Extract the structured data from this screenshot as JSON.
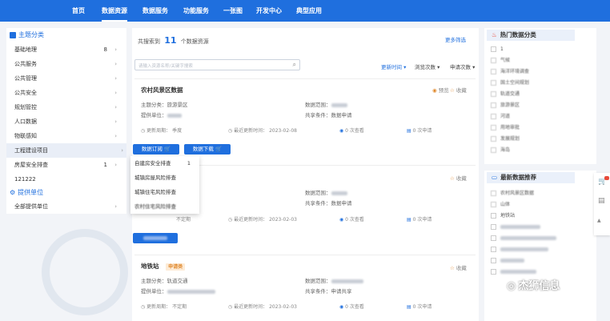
{
  "nav": {
    "items": [
      "首页",
      "数据资源",
      "数据服务",
      "功能服务",
      "一张图",
      "开发中心",
      "典型应用"
    ]
  },
  "sidebar": {
    "theme_title": "主题分类",
    "rows": [
      {
        "label": "基础地理",
        "count": "8"
      },
      {
        "label": "公共服务",
        "count": ""
      },
      {
        "label": "公共管理",
        "count": ""
      },
      {
        "label": "公共安全",
        "count": ""
      },
      {
        "label": "规划管控",
        "count": ""
      },
      {
        "label": "人口数据",
        "count": ""
      },
      {
        "label": "物联感知",
        "count": ""
      },
      {
        "label": "工程建设项目",
        "count": ""
      },
      {
        "label": "房屋安全排查",
        "count": "1"
      },
      {
        "label": "121222",
        "count": ""
      }
    ],
    "provider_title": "提供单位",
    "provider_row": "全部提供单位"
  },
  "main": {
    "found_prefix": "共搜索到",
    "found_count": "11",
    "found_suffix": "个数据资源",
    "more_filter": "更多筛选",
    "search_placeholder": "请输入资源名称/关键字搜索",
    "sort": [
      "更新时间",
      "浏览次数",
      "申请次数"
    ],
    "cards": [
      {
        "title": "农村风景区数据",
        "preview": "预览",
        "fav": "收藏",
        "theme_label": "主题分类：",
        "theme": "旅游景区",
        "provider_label": "提供单位：",
        "range_label": "数据范围：",
        "share_label": "共享条件：",
        "share": "数据申请",
        "freq_label": "更新周期：",
        "freq": "季度",
        "updated_label": "最近更新时间：",
        "updated": "2023-02-08",
        "views": "0 次查看",
        "applies": "0 次申请"
      },
      {
        "fav": "收藏",
        "range_label": "数据范围：",
        "share_label": "共享条件：",
        "share": "数据申请",
        "freq": "不定期",
        "updated_label": "最近更新时间：",
        "updated": "2023-02-03",
        "views": "0 次查看",
        "applies": "0 次申请"
      },
      {
        "title": "地铁站",
        "tag": "申请类",
        "fav": "收藏",
        "theme_label": "主题分类：",
        "theme": "轨道交通",
        "provider_label": "提供单位：",
        "range_label": "数据范围：",
        "share_label": "共享条件：",
        "share": "申请共享",
        "freq_label": "更新周期：",
        "freq": "不定期",
        "updated_label": "最近更新时间：",
        "updated": "2023-02-03",
        "views": "0 次查看",
        "applies": "0 次申请"
      }
    ],
    "subscribe_btn": "数据订阅",
    "download_btn": "数据下载",
    "dropdown": [
      {
        "label": "自建房安全排查",
        "count": "1"
      },
      {
        "label": "城镇房屋风险排查",
        "count": ""
      },
      {
        "label": "城镇住宅风险排查",
        "count": ""
      },
      {
        "label": "农村住宅风险排查",
        "count": ""
      }
    ]
  },
  "right": {
    "hot_title": "热门数据分类",
    "hot_items": [
      "1",
      "气候",
      "海洋环境调查",
      "国土空间规划",
      "轨道交通",
      "旅游景区",
      "河道",
      "用地审批",
      "发展规划",
      "海岛"
    ],
    "new_title": "最新数据推荐",
    "new_items": [
      "农村风景区数据",
      "山体",
      "地铁站"
    ]
  },
  "watermark": "杰狮信息",
  "colors": {
    "primary": "#1f6fde",
    "tag_bg": "#fdebd6",
    "tag_fg": "#e08a2f"
  }
}
